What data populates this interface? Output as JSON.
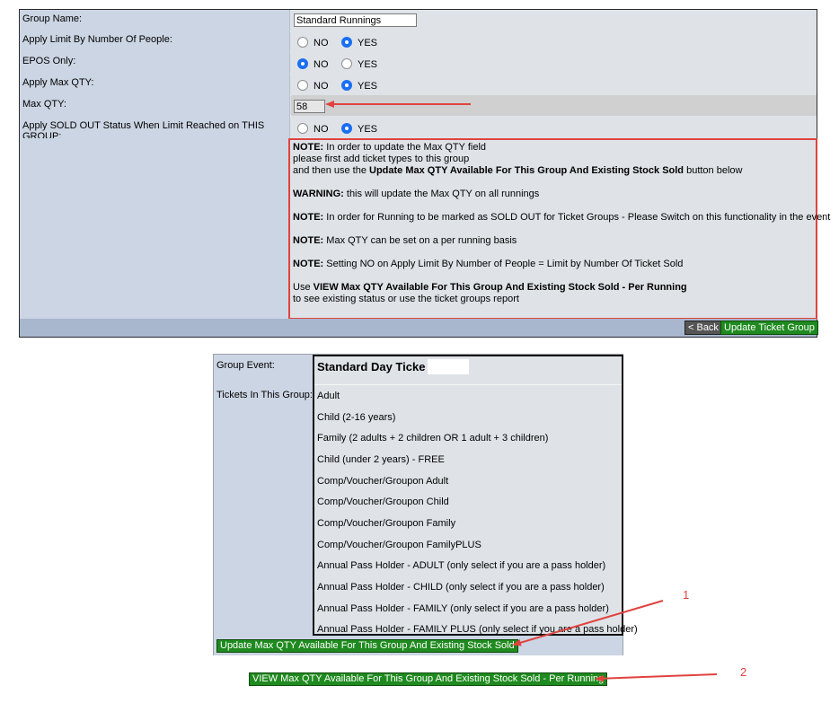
{
  "form": {
    "rows": [
      {
        "label": "Group Name:",
        "value": "Standard Runnings"
      },
      {
        "label": "Apply Limit By Number Of People:",
        "options": [
          "NO",
          "YES"
        ],
        "selected": "YES"
      },
      {
        "label": "EPOS Only:",
        "options": [
          "NO",
          "YES"
        ],
        "selected": "NO"
      },
      {
        "label": "Apply Max QTY:",
        "options": [
          "NO",
          "YES"
        ],
        "selected": "YES"
      },
      {
        "label": "Max QTY:",
        "value": "58"
      },
      {
        "label": "Apply SOLD OUT Status When Limit Reached on THIS GROUP:",
        "options": [
          "NO",
          "YES"
        ],
        "selected": "YES"
      }
    ],
    "notes": {
      "n1_bold": "NOTE:",
      "n1_text": " In order to update the Max QTY field",
      "n1_line2": "please first add ticket types to this group",
      "n1_line3_pre": "and then use the ",
      "n1_line3_bold": "Update Max QTY Available For This Group And Existing Stock Sold",
      "n1_line3_post": " button below",
      "warning_bold": "WARNING:",
      "warning_text": " this will update the Max QTY on all runnings",
      "n2_bold": "NOTE:",
      "n2_text": " In order for Running to be marked as SOLD OUT for Ticket Groups - Please Switch on this functionality in the event",
      "n3_bold": "NOTE:",
      "n3_text": " Max QTY can be set on a per running basis",
      "n4_bold": "NOTE:",
      "n4_text": " Setting NO on Apply Limit By Number of People = Limit by Number Of Ticket Sold",
      "use_pre": "Use ",
      "use_bold": "VIEW Max QTY Available For This Group And Existing Stock Sold - Per Running",
      "use_line2": "to see existing status or use the ticket groups report"
    },
    "back_label": "< Back",
    "update_group_label": "Update Ticket Group"
  },
  "event": {
    "group_event_label": "Group Event:",
    "group_event_value": "Standard Day Ticke",
    "tickets_label": "Tickets In This Group:",
    "tickets": [
      "Adult",
      "Child (2-16 years)",
      "Family (2 adults + 2 children OR 1 adult + 3 children)",
      "Child (under 2 years) - FREE",
      "Comp/Voucher/Groupon Adult",
      "Comp/Voucher/Groupon Child",
      "Comp/Voucher/Groupon Family",
      "Comp/Voucher/Groupon FamilyPLUS",
      "Annual Pass Holder - ADULT (only select if you are a pass holder)",
      "Annual Pass Holder - CHILD (only select if you are a pass holder)",
      "Annual Pass Holder - FAMILY (only select if you are a pass holder)",
      "Annual Pass Holder - FAMILY PLUS (only select if you are a pass holder)"
    ],
    "update_max_qty_label": "Update Max QTY Available For This Group And Existing Stock Sold"
  },
  "view_max_qty_label": "VIEW Max QTY Available For This Group And Existing Stock Sold - Per Running",
  "annotations": {
    "marker_1": "1",
    "marker_2": "2"
  },
  "colors": {
    "annotation": "#e0433f",
    "button_green": "#1f8a1f",
    "label_bg": "#ccd5e3"
  }
}
